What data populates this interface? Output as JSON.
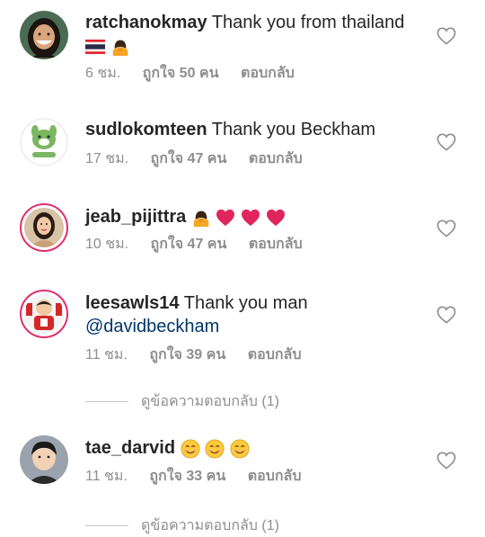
{
  "comments": [
    {
      "username": "ratchanokmay",
      "text": "Thank you from thailand",
      "time": "6 ชม.",
      "likes": "ถูกใจ 50 คน",
      "reply": "ตอบกลับ",
      "avatar_icon": "woman-face-avatar",
      "emojis": [
        "thai-flag-icon",
        "bowing-person-icon"
      ]
    },
    {
      "username": "sudlokomteen",
      "text": "Thank you Beckham",
      "time": "17 ชม.",
      "likes": "ถูกใจ 47 คน",
      "reply": "ตอบกลับ",
      "avatar_icon": "green-dog-logo"
    },
    {
      "username": "jeab_pijittra",
      "text": "",
      "time": "10 ชม.",
      "likes": "ถูกใจ 47 คน",
      "reply": "ตอบกลับ",
      "avatar_icon": "woman-portrait-avatar",
      "emojis": [
        "bowing-person-icon",
        "red-heart-icon",
        "red-heart-icon",
        "red-heart-icon"
      ]
    },
    {
      "username": "leesawls14",
      "text": "Thank you man",
      "mention": "@davidbeckham",
      "time": "11 ชม.",
      "likes": "ถูกใจ 39 คน",
      "reply": "ตอบกลับ",
      "avatar_icon": "cartoon-football-avatar",
      "view_replies": "ดูข้อความตอบกลับ (1)"
    },
    {
      "username": "tae_darvid",
      "text": "",
      "time": "11 ชม.",
      "likes": "ถูกใจ 33 คน",
      "reply": "ตอบกลับ",
      "avatar_icon": "man-face-avatar",
      "emojis": [
        "smiling-face-icon",
        "smiling-face-icon",
        "smiling-face-icon"
      ],
      "view_replies": "ดูข้อความตอบกลับ (1)"
    }
  ],
  "colors": {
    "text": "#262626",
    "meta": "#8e8e8e",
    "mention": "#003569",
    "heart_outline": "#8e8e8e",
    "story_ring": "#e1306c"
  }
}
